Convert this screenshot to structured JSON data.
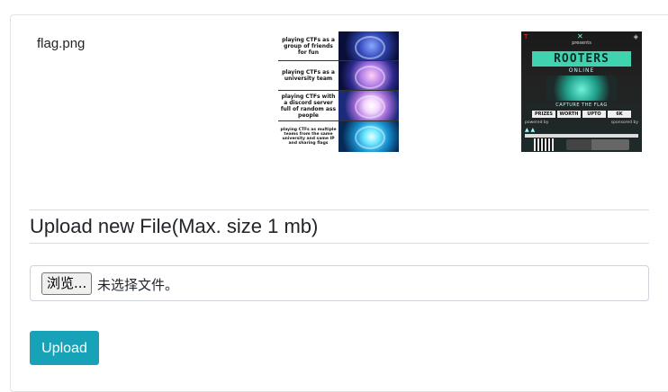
{
  "files": [
    {
      "name": "flag.png"
    }
  ],
  "meme": {
    "captions": [
      "playing CTFs as a group of friends for fun",
      "playing CTFs as a university team",
      "playing CTFs with a discord server full of random ass people",
      "playing CTFs as multiple teams from the same university and same IP and sharing flags"
    ],
    "icons": [
      "brain-small-icon",
      "brain-glowing-icon",
      "brain-bright-icon",
      "brain-cosmic-icon"
    ]
  },
  "poster": {
    "presents": "presents",
    "title": "ROOTERS",
    "subtitle": "ONLINE",
    "ctf_label": "CAPTURE THE FLAG",
    "prizes": [
      "PRIZES",
      "WORTH",
      "UPTO",
      "6K"
    ],
    "powered": "powered by",
    "sponsored": "sponsored by"
  },
  "upload": {
    "title": "Upload new File(Max. size 1 mb)",
    "browse_label": "浏览...",
    "no_file_text": "未选择文件。",
    "submit_label": "Upload"
  },
  "colors": {
    "primary_button": "#17a2b8",
    "border": "#ced4da"
  }
}
